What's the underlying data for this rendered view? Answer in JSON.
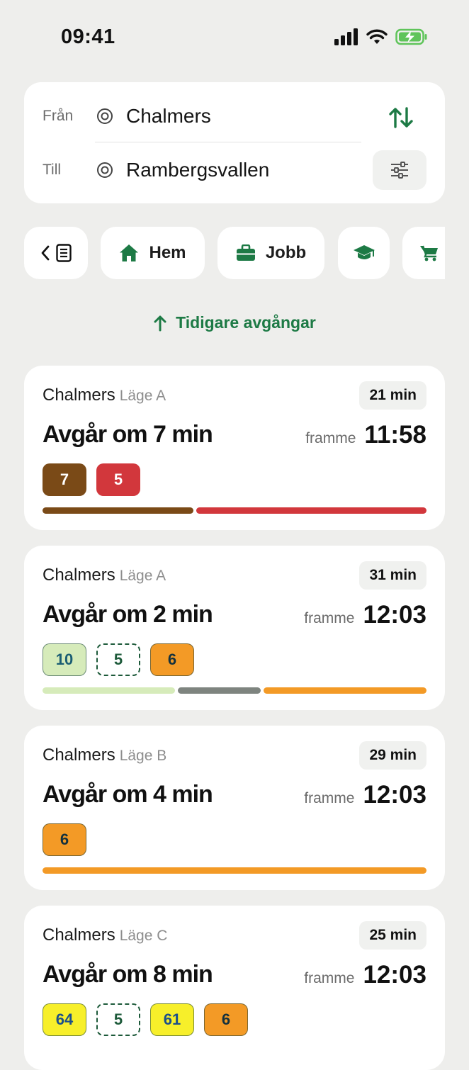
{
  "status": {
    "time": "09:41",
    "icons": [
      "signal-icon",
      "wifi-icon",
      "battery-charging-icon"
    ]
  },
  "route": {
    "from_label": "Från",
    "from_value": "Chalmers",
    "to_label": "Till",
    "to_value": "Rambergsvallen"
  },
  "chips": [
    {
      "name": "history",
      "label": "",
      "icon": "history-icon"
    },
    {
      "name": "home",
      "label": "Hem",
      "icon": "home-icon"
    },
    {
      "name": "work",
      "label": "Jobb",
      "icon": "briefcase-icon"
    },
    {
      "name": "school",
      "label": "",
      "icon": "graduation-cap-icon"
    },
    {
      "name": "shop",
      "label": "",
      "icon": "cart-icon"
    }
  ],
  "earlier_label": "Tidigare avgångar",
  "colors": {
    "accent": "#1d7a45",
    "brown": "#7a4a17",
    "red": "#d2373c",
    "orange": "#f39a26",
    "lightgreen": "#d6ebba",
    "yellow": "#f7ef2a",
    "gray": "#7e847f"
  },
  "trips": [
    {
      "stop": "Chalmers",
      "position": "Läge A",
      "duration": "21 min",
      "departs": "Avgår om 7 min",
      "arrive_word": "framme",
      "arrive_time": "11:58",
      "lines": [
        {
          "label": "7",
          "bg": "#7a4a17",
          "fg": "#ffffff",
          "border": "none"
        },
        {
          "label": "5",
          "bg": "#d2373c",
          "fg": "#ffffff",
          "border": "none"
        }
      ],
      "legs": [
        {
          "color": "#7a4a17",
          "share": 0.395
        },
        {
          "color": "#d2373c",
          "share": 0.605
        }
      ]
    },
    {
      "stop": "Chalmers",
      "position": "Läge A",
      "duration": "31 min",
      "departs": "Avgår om 2 min",
      "arrive_word": "framme",
      "arrive_time": "12:03",
      "lines": [
        {
          "label": "10",
          "bg": "#d6ebba",
          "fg": "#1b5d73",
          "border": "solid"
        },
        {
          "label": "5",
          "bg": "#ffffff",
          "fg": "#1d5a3a",
          "border": "dashed"
        },
        {
          "label": "6",
          "bg": "#f39a26",
          "fg": "#14313d",
          "border": "solid"
        }
      ],
      "legs": [
        {
          "color": "#d6ebba",
          "share": 0.35
        },
        {
          "color": "#7e847f",
          "share": 0.22
        },
        {
          "color": "#f39a26",
          "share": 0.43
        }
      ]
    },
    {
      "stop": "Chalmers",
      "position": "Läge B",
      "duration": "29 min",
      "departs": "Avgår om 4 min",
      "arrive_word": "framme",
      "arrive_time": "12:03",
      "lines": [
        {
          "label": "6",
          "bg": "#f39a26",
          "fg": "#14313d",
          "border": "solid"
        }
      ],
      "legs": [
        {
          "color": "#f39a26",
          "share": 1.0
        }
      ]
    },
    {
      "stop": "Chalmers",
      "position": "Läge C",
      "duration": "25 min",
      "departs": "Avgår om 8 min",
      "arrive_word": "framme",
      "arrive_time": "12:03",
      "lines": [
        {
          "label": "64",
          "bg": "#f7ef2a",
          "fg": "#1b4f8a",
          "border": "solid"
        },
        {
          "label": "5",
          "bg": "#ffffff",
          "fg": "#1d5a3a",
          "border": "dashed"
        },
        {
          "label": "61",
          "bg": "#f7ef2a",
          "fg": "#1b4f8a",
          "border": "solid"
        },
        {
          "label": "6",
          "bg": "#f39a26",
          "fg": "#14313d",
          "border": "solid"
        }
      ],
      "legs": []
    }
  ]
}
